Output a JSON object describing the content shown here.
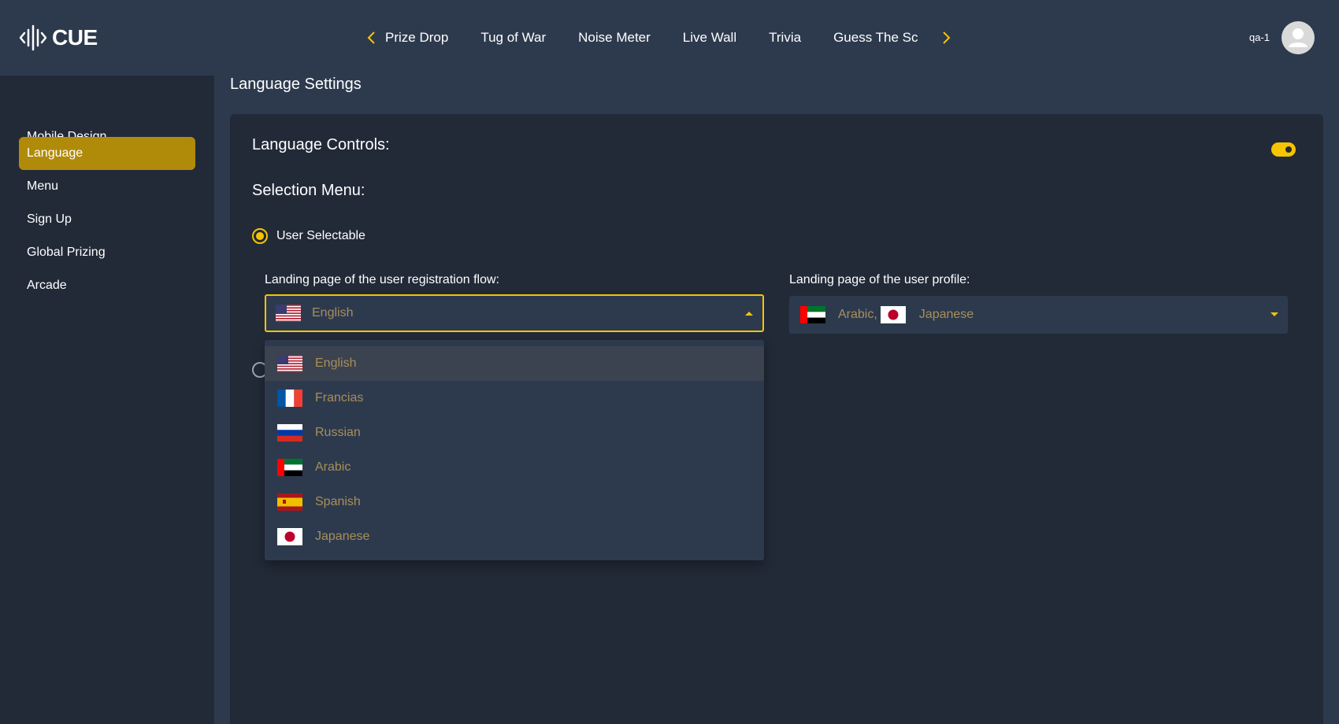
{
  "header": {
    "logo_text": "CUE",
    "tabs": [
      {
        "label": "Prize Drop"
      },
      {
        "label": "Tug of War"
      },
      {
        "label": "Noise Meter"
      },
      {
        "label": "Live Wall"
      },
      {
        "label": "Trivia"
      },
      {
        "label": "Guess The Sc"
      }
    ],
    "user_name": "qa-1",
    "icons": {
      "prev": "chevron-left-icon",
      "next": "chevron-right-icon",
      "avatar": "user-avatar-icon"
    }
  },
  "sidebar": {
    "items": [
      {
        "label": "Mobile Design",
        "active": false
      },
      {
        "label": "Language",
        "active": true
      },
      {
        "label": "Menu",
        "active": false
      },
      {
        "label": "Sign Up",
        "active": false
      },
      {
        "label": "Global Prizing",
        "active": false
      },
      {
        "label": "Arcade",
        "active": false
      }
    ]
  },
  "main": {
    "page_title": "Language Settings",
    "language_controls_label": "Language Controls:",
    "language_controls_enabled": true,
    "selection_menu_label": "Selection Menu:",
    "radio_user_selectable": {
      "label": "User Selectable",
      "checked": true
    },
    "registration_field": {
      "label": "Landing page of the user registration flow:",
      "value": "English",
      "flag": "us",
      "open": true
    },
    "profile_field": {
      "label": "Landing page of the user profile:",
      "values": [
        "Arabic,",
        "Japanese"
      ],
      "flags": [
        "ae",
        "jp"
      ]
    },
    "dropdown_options": [
      {
        "label": "English",
        "flag": "us",
        "highlighted": true
      },
      {
        "label": "Francias",
        "flag": "fr",
        "highlighted": false
      },
      {
        "label": "Russian",
        "flag": "ru",
        "highlighted": false
      },
      {
        "label": "Arabic",
        "flag": "ae",
        "highlighted": false
      },
      {
        "label": "Spanish",
        "flag": "es",
        "highlighted": false
      },
      {
        "label": "Japanese",
        "flag": "jp",
        "highlighted": false
      }
    ]
  },
  "colors": {
    "accent": "#f6c400",
    "active_sidebar": "#b08b0a",
    "background": "#2d3a4e",
    "panel": "#222a38",
    "option_text": "#a88f5a"
  }
}
